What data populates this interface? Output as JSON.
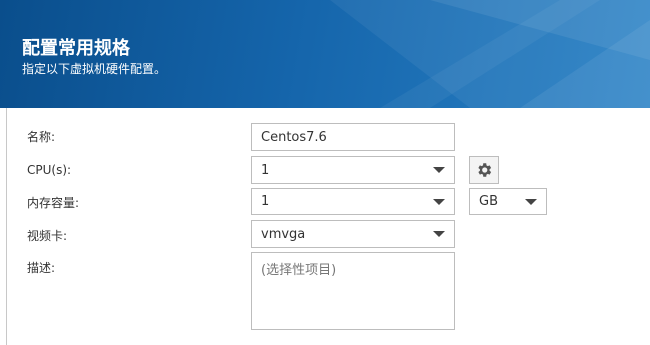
{
  "header": {
    "title": "配置常用规格",
    "subtitle": "指定以下虚拟机硬件配置。"
  },
  "form": {
    "name_label": "名称:",
    "name_value": "Centos7.6",
    "cpu_label": "CPU(s):",
    "cpu_value": "1",
    "memory_label": "内存容量:",
    "memory_value": "1",
    "memory_unit": "GB",
    "video_label": "视频卡:",
    "video_value": "vmvga",
    "description_label": "描述:",
    "description_placeholder": "(选择性项目)"
  },
  "icons": {
    "cpu_settings": "gear-icon",
    "dropdown": "chevron-down-icon"
  },
  "colors": {
    "header_dark": "#0a4e8c",
    "header_light": "#2a82c6"
  }
}
